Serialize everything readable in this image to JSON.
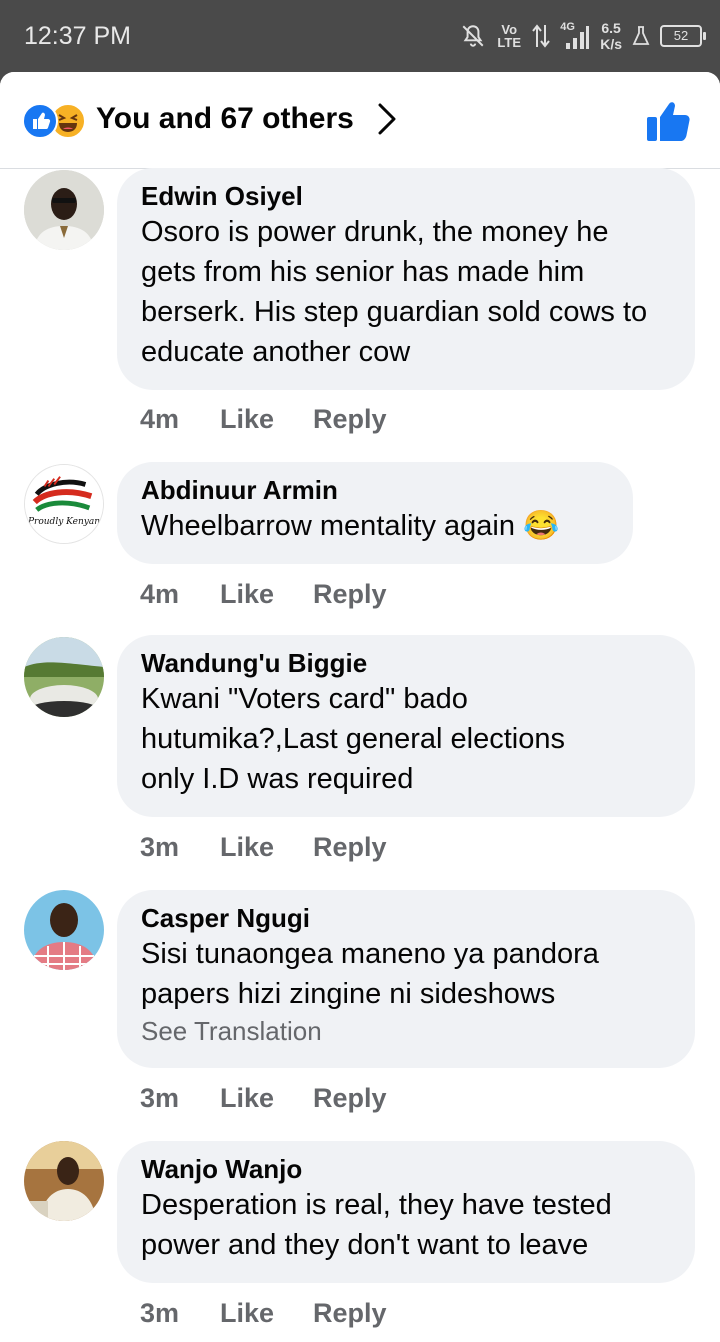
{
  "status_bar": {
    "time": "12:37 PM",
    "network": "Vo LTE",
    "signal_label": "4G",
    "speed_value": "6.5",
    "speed_unit": "K/s",
    "battery": "52"
  },
  "header": {
    "reaction_summary": "You and 67 others",
    "reaction_icons": [
      "like-reaction-icon",
      "haha-reaction-icon"
    ],
    "accent_color": "#1877f2"
  },
  "comments": [
    {
      "author": "Edwin Osiyel",
      "text": "Osoro is power drunk, the money he gets from his senior has made him berserk. His step guardian  sold cows to educate another cow",
      "time": "4m",
      "like": "Like",
      "reply": "Reply"
    },
    {
      "author": "Abdinuur Armin",
      "text": "Wheelbarrow mentality again",
      "emoji": "😂",
      "avatar_text": "Proudly Kenyan",
      "time": "4m",
      "like": "Like",
      "reply": "Reply"
    },
    {
      "author": "Wandung'u Biggie",
      "text": "Kwani \"Voters card\" bado hutumika?,Last general elections only I.D was required",
      "time": "3m",
      "like": "Like",
      "reply": "Reply"
    },
    {
      "author": "Casper Ngugi",
      "text": "Sisi tunaongea maneno ya pandora papers hizi zingine ni sideshows",
      "see_translation": "See Translation",
      "time": "3m",
      "like": "Like",
      "reply": "Reply"
    },
    {
      "author": "Wanjo Wanjo",
      "text": "Desperation is real, they have tested power and they don't want to leave",
      "time": "3m",
      "like": "Like",
      "reply": "Reply"
    }
  ]
}
